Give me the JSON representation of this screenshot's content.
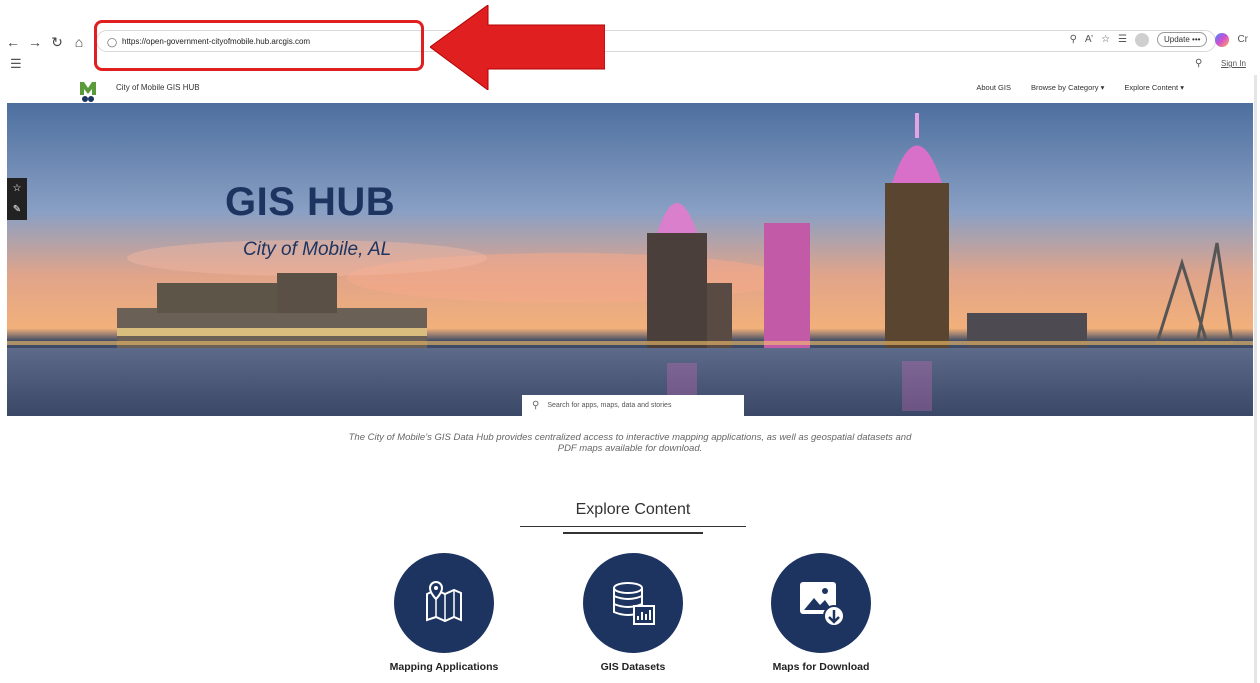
{
  "browser": {
    "url": "https://open-government-cityofmobile.hub.arcgis.com",
    "update_label": "Update",
    "more_label": "•••",
    "copilot_label": "Cr"
  },
  "header": {
    "site_title": "City of Mobile GIS HUB",
    "sign_in": "Sign In",
    "nav": [
      "About GIS",
      "Browse by Category ▾",
      "Explore Content ▾"
    ]
  },
  "hero": {
    "title": "GIS HUB",
    "subtitle": "City of Mobile, AL",
    "search_placeholder": "Search for apps, maps, data and stories"
  },
  "intro_text": "The City of Mobile’s GIS Data Hub provides centralized access to interactive mapping applications, as well as geospatial datasets and PDF maps available for download.",
  "explore": {
    "title": "Explore Content",
    "cards": [
      {
        "label": "Mapping Applications",
        "icon": "map-pin-icon"
      },
      {
        "label": "GIS Datasets",
        "icon": "database-chart-icon"
      },
      {
        "label": "Maps for Download",
        "icon": "image-download-icon"
      }
    ]
  },
  "colors": {
    "brand_navy": "#1d3461",
    "annotation_red": "#e02020"
  }
}
